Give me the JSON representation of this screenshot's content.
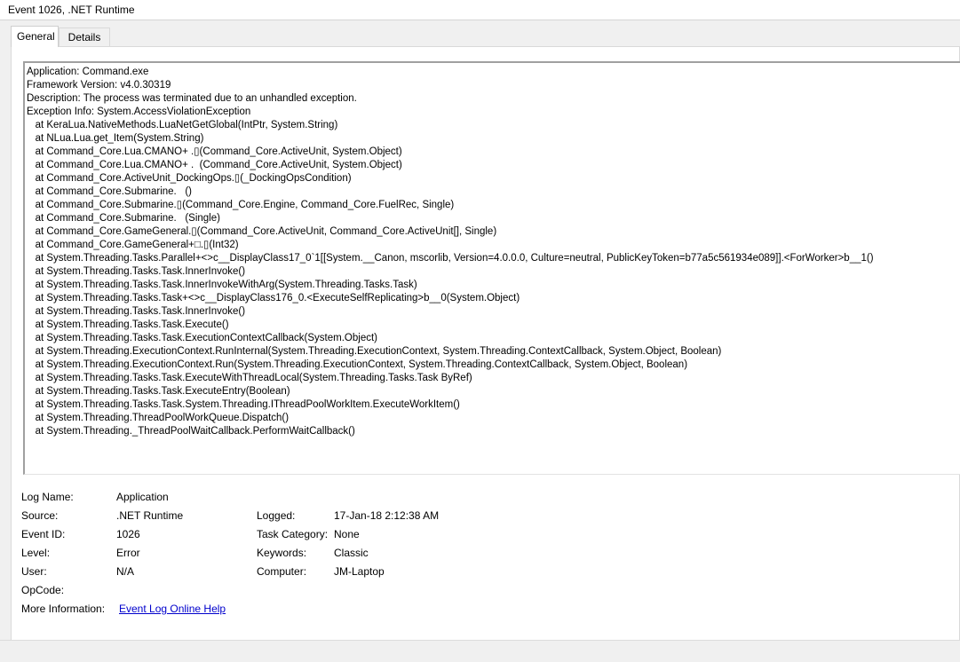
{
  "window": {
    "title": "Event 1026, .NET Runtime"
  },
  "tabs": [
    {
      "label": "General",
      "active": true
    },
    {
      "label": "Details",
      "active": false
    }
  ],
  "description": {
    "lines": [
      "Application: Command.exe",
      "Framework Version: v4.0.30319",
      "Description: The process was terminated due to an unhandled exception.",
      "Exception Info: System.AccessViolationException",
      "   at KeraLua.NativeMethods.LuaNetGetGlobal(IntPtr, System.String)",
      "   at NLua.Lua.get_Item(System.String)",
      "   at Command_Core.Lua.CMANO+ .▯(Command_Core.ActiveUnit, System.Object)",
      "   at Command_Core.Lua.CMANO+ .  (Command_Core.ActiveUnit, System.Object)",
      "   at Command_Core.ActiveUnit_DockingOps.▯(_DockingOpsCondition)",
      "   at Command_Core.Submarine.   ()",
      "   at Command_Core.Submarine.▯(Command_Core.Engine, Command_Core.FuelRec, Single)",
      "   at Command_Core.Submarine.   (Single)",
      "   at Command_Core.GameGeneral.▯(Command_Core.ActiveUnit, Command_Core.ActiveUnit[], Single)",
      "   at Command_Core.GameGeneral+□.▯(Int32)",
      "   at System.Threading.Tasks.Parallel+<>c__DisplayClass17_0`1[[System.__Canon, mscorlib, Version=4.0.0.0, Culture=neutral, PublicKeyToken=b77a5c561934e089]].<ForWorker>b__1()",
      "   at System.Threading.Tasks.Task.InnerInvoke()",
      "   at System.Threading.Tasks.Task.InnerInvokeWithArg(System.Threading.Tasks.Task)",
      "   at System.Threading.Tasks.Task+<>c__DisplayClass176_0.<ExecuteSelfReplicating>b__0(System.Object)",
      "   at System.Threading.Tasks.Task.InnerInvoke()",
      "   at System.Threading.Tasks.Task.Execute()",
      "   at System.Threading.Tasks.Task.ExecutionContextCallback(System.Object)",
      "   at System.Threading.ExecutionContext.RunInternal(System.Threading.ExecutionContext, System.Threading.ContextCallback, System.Object, Boolean)",
      "   at System.Threading.ExecutionContext.Run(System.Threading.ExecutionContext, System.Threading.ContextCallback, System.Object, Boolean)",
      "   at System.Threading.Tasks.Task.ExecuteWithThreadLocal(System.Threading.Tasks.Task ByRef)",
      "   at System.Threading.Tasks.Task.ExecuteEntry(Boolean)",
      "   at System.Threading.Tasks.Task.System.Threading.IThreadPoolWorkItem.ExecuteWorkItem()",
      "   at System.Threading.ThreadPoolWorkQueue.Dispatch()",
      "   at System.Threading._ThreadPoolWaitCallback.PerformWaitCallback()"
    ]
  },
  "properties": {
    "log_name": {
      "label": "Log Name:",
      "value": "Application"
    },
    "source": {
      "label": "Source:",
      "value": ".NET Runtime"
    },
    "logged": {
      "label": "Logged:",
      "value": "17-Jan-18 2:12:38 AM"
    },
    "event_id": {
      "label": "Event ID:",
      "value": "1026"
    },
    "task_category": {
      "label": "Task Category:",
      "value": "None"
    },
    "level": {
      "label": "Level:",
      "value": "Error"
    },
    "keywords": {
      "label": "Keywords:",
      "value": "Classic"
    },
    "user": {
      "label": "User:",
      "value": "N/A"
    },
    "computer": {
      "label": "Computer:",
      "value": "JM-Laptop"
    },
    "opcode": {
      "label": "OpCode:",
      "value": ""
    },
    "more_info": {
      "label": "More Information:",
      "link": "Event Log Online Help"
    }
  },
  "colors": {
    "link": "#0000cc",
    "background": "#f0f0f0",
    "panel": "#ffffff"
  }
}
